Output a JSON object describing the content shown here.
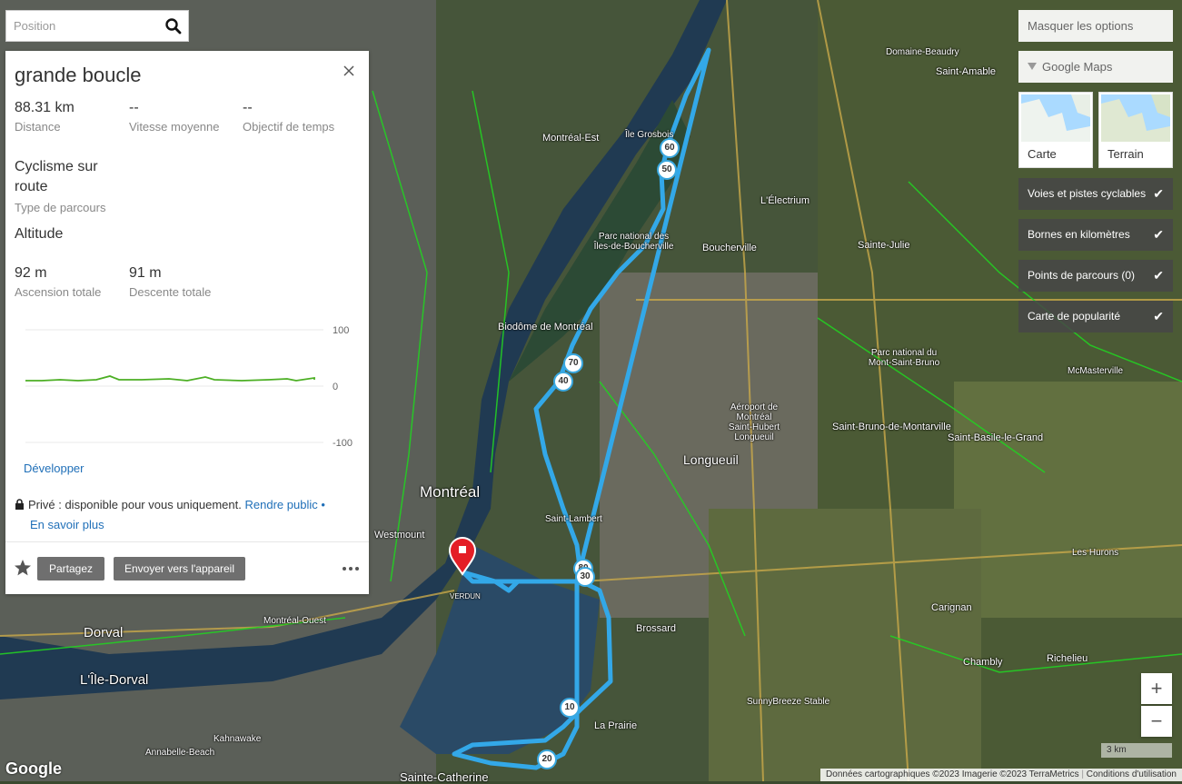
{
  "search": {
    "placeholder": "Position"
  },
  "route": {
    "title": "grande boucle",
    "distance": {
      "value": "88.31 km",
      "label": "Distance"
    },
    "avg_speed": {
      "value": "--",
      "label": "Vitesse moyenne"
    },
    "time_goal": {
      "value": "--",
      "label": "Objectif de temps"
    },
    "route_type": {
      "value": "Cyclisme sur route",
      "label": "Type de parcours"
    },
    "altitude_heading": "Altitude",
    "ascent": {
      "value": "92 m",
      "label": "Ascension totale"
    },
    "descent": {
      "value": "91 m",
      "label": "Descente totale"
    },
    "elevation_chart": {
      "y_ticks": [
        "100",
        "0",
        "-100"
      ],
      "ylim": [
        -100,
        100
      ]
    },
    "expand_link": "Développer",
    "privacy_text": "Privé : disponible pour vous uniquement.",
    "make_public_link": "Rendre public",
    "separator": "•",
    "learn_more_link": "En savoir plus",
    "share_button": "Partagez",
    "send_button": "Envoyer vers l'appareil"
  },
  "options": {
    "hide_options": "Masquer les options",
    "provider": "Google Maps",
    "map_types": [
      "Carte",
      "Terrain"
    ],
    "toggles": [
      {
        "label": "Voies et pistes cyclables",
        "checked": true
      },
      {
        "label": "Bornes en kilomètres",
        "checked": true
      },
      {
        "label": "Points de parcours (0)",
        "checked": true
      },
      {
        "label": "Carte de popularité",
        "checked": true
      }
    ]
  },
  "zoom": {
    "in": "+",
    "out": "−"
  },
  "scale": "3 km",
  "attribution": {
    "data": "Données cartographiques ©2023 Imagerie ©2023 TerraMetrics",
    "terms": "Conditions d'utilisation"
  },
  "google_logo": "Google",
  "km_markers": [
    "60",
    "50",
    "70",
    "40",
    "80",
    "30",
    "10",
    "20"
  ],
  "map_labels": {
    "montreal": "Montréal",
    "longueuil": "Longueuil",
    "boucherville": "Boucherville",
    "brossard": "Brossard",
    "laprairie": "La Prairie",
    "saint_lambert": "Saint-Lambert",
    "dorval": "Dorval",
    "ile_dorval": "L'Île-Dorval",
    "montreal_est": "Montréal-Est",
    "westmount": "Westmount",
    "verdun": "VERDUN",
    "chambly": "Chambly",
    "carignan": "Carignan",
    "richelieu": "Richelieu",
    "sainte_julie": "Sainte-Julie",
    "saint_amable": "Saint-Amable",
    "saint_basile": "Saint-Basile-le-Grand",
    "saint_bruno": "Saint-Bruno-de-Montarville",
    "mont_saint_bruno": "Parc national du Mont-Saint-Bruno",
    "iles_boucherville": "Parc national des Îles-de-Boucherville",
    "biodome": "Biodôme de Montréal",
    "electrium": "L'Électrium",
    "kahnawake": "Kahnawake",
    "annabelle": "Annabelle-Beach",
    "sainte_catherine": "Sainte-Catherine",
    "domaine_beaudry": "Domaine-Beaudry",
    "mcmasterville": "McMasterville",
    "les_hurons": "Les Hurons",
    "aeroport": "Aéroport de Montréal Saint-Hubert Longueuil",
    "ile_grosbois": "Île Grosbois",
    "montreal_ouest": "Montréal-Ouest",
    "sunnybreeze": "SunnyBreeze Stable"
  }
}
